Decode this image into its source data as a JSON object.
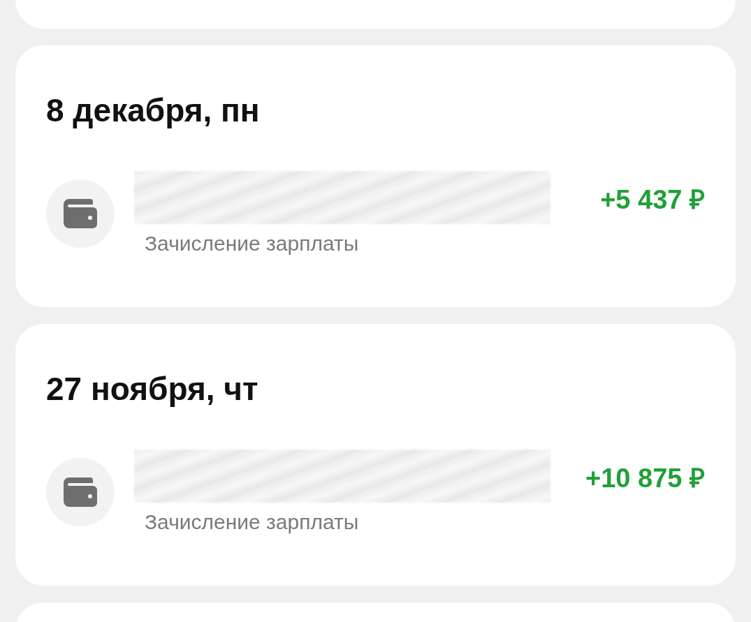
{
  "operations": [
    {
      "date": "8 декабря, пн",
      "category": "Зачисление зарплаты",
      "amount": "+5 437 ₽",
      "kind": "income"
    },
    {
      "date": "27 ноября, чт",
      "category": "Зачисление зарплаты",
      "amount": "+10 875 ₽",
      "kind": "income"
    }
  ]
}
